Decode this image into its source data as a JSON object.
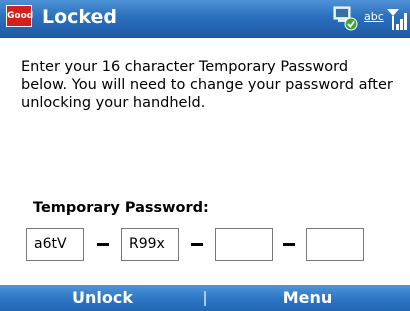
{
  "titlebar": {
    "logo_text": "Good",
    "title": "Locked",
    "input_mode": "abc",
    "icons": [
      "network-status-icon",
      "signal-strength-icon"
    ]
  },
  "main": {
    "instructions": "Enter your 16 character Temporary Password below. You will need to change your password after unlocking your handheld.",
    "password_label": "Temporary Password:",
    "password_fields": [
      "a6tV",
      "R99x",
      "",
      ""
    ]
  },
  "softkeys": {
    "left": "Unlock",
    "right": "Menu"
  },
  "colors": {
    "bar_blue": "#2a6fbd",
    "logo_red": "#d51f1f"
  }
}
